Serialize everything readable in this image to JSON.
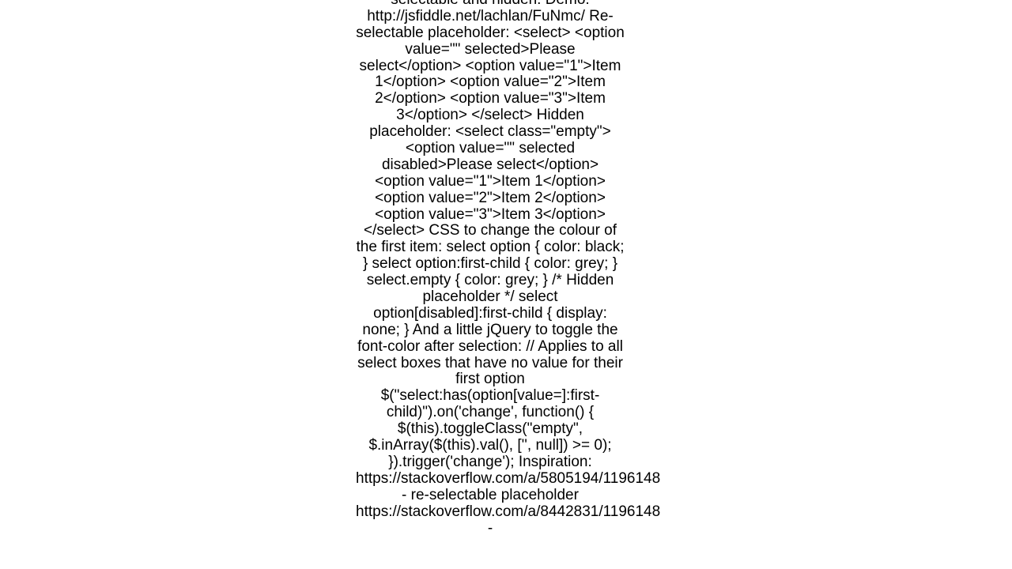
{
  "document": {
    "body_text": "selectable and hidden: Demo: http://jsfiddle.net/lachlan/FuNmc/ Re-selectable placeholder: <select>     <option value=\"\" selected>Please select</option>     <option value=\"1\">Item 1</option>     <option value=\"2\">Item 2</option>     <option value=\"3\">Item 3</option> </select>  Hidden placeholder: <select class=\"empty\">     <option value=\"\" selected disabled>Please select</option>     <option value=\"1\">Item 1</option>     <option value=\"2\">Item 2</option>     <option value=\"3\">Item 3</option> </select>  CSS to change the colour of the first item: select option { color: black; } select option:first-child { color: grey; } select.empty { color: grey; } /* Hidden placeholder */ select option[disabled]:first-child { display: none; }  And a little jQuery to toggle the font-color after selection: // Applies to all select boxes that have no value for their first option $(\"select:has(option[value=]:first-child)\").on('change', function() {     $(this).toggleClass(\"empty\", $.inArray($(this).val(), ['', null]) >= 0); }).trigger('change');  Inspiration: https://stackoverflow.com/a/5805194/1196148 - re-selectable placeholder https://stackoverflow.com/a/8442831/1196148 -"
  }
}
